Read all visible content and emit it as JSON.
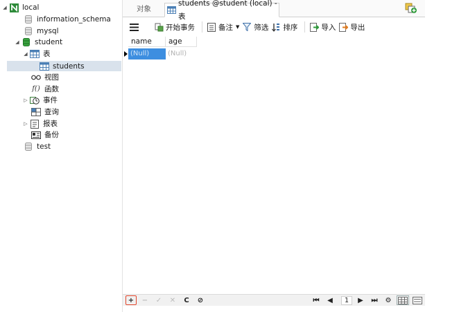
{
  "tree": {
    "connection": "local",
    "databases": [
      "information_schema",
      "mysql",
      "student"
    ],
    "student_children": {
      "tables_label": "表",
      "tables": [
        "students"
      ],
      "views_label": "视图",
      "functions_label": "函数",
      "events_label": "事件",
      "queries_label": "查询",
      "reports_label": "报表",
      "backup_label": "备份"
    },
    "other_db": "test"
  },
  "tabs": {
    "objects": "对象",
    "active": "students @student (local) - 表"
  },
  "toolbar": {
    "begin_transaction": "开始事务",
    "memo": "备注",
    "filter": "筛选",
    "sort": "排序",
    "import": "导入",
    "export": "导出"
  },
  "grid": {
    "columns": [
      "name",
      "age"
    ],
    "rows": [
      [
        "(Null)",
        "(Null)"
      ]
    ]
  },
  "statusbar": {
    "add": "+",
    "remove": "−",
    "apply": "✓",
    "discard": "✕",
    "refresh": "C",
    "stop": "⊘",
    "page": "1"
  },
  "colors": {
    "accent": "#3d8ee0",
    "selection_bg": "#d9e2ec",
    "add_highlight": "#e2452b"
  }
}
